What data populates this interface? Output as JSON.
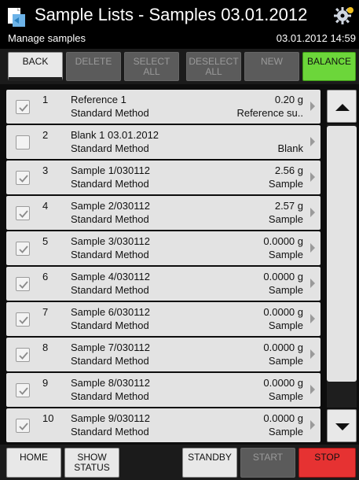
{
  "header": {
    "title": "Sample Lists - Samples 03.01.2012",
    "subtitle": "Manage samples",
    "datetime": "03.01.2012 14:59",
    "app_icon": "document-icon",
    "settings_icon": "gear-icon"
  },
  "toolbar": {
    "back": "BACK",
    "delete": "DELETE",
    "select_all": "SELECT\nALL",
    "deselect_all": "DESELECT\nALL",
    "new": "NEW",
    "balance": "BALANCE"
  },
  "rows": [
    {
      "checked": true,
      "index": "1",
      "name": "Reference 1",
      "method": "Standard Method",
      "amount": "0.20 g",
      "type": "Reference su.."
    },
    {
      "checked": false,
      "index": "2",
      "name": "Blank 1 03.01.2012",
      "method": "Standard Method",
      "amount": "",
      "type": "Blank"
    },
    {
      "checked": true,
      "index": "3",
      "name": "Sample 1/030112",
      "method": "Standard Method",
      "amount": "2.56 g",
      "type": "Sample"
    },
    {
      "checked": true,
      "index": "4",
      "name": "Sample 2/030112",
      "method": "Standard Method",
      "amount": "2.57 g",
      "type": "Sample"
    },
    {
      "checked": true,
      "index": "5",
      "name": "Sample 3/030112",
      "method": "Standard Method",
      "amount": "0.0000 g",
      "type": "Sample"
    },
    {
      "checked": true,
      "index": "6",
      "name": "Sample 4/030112",
      "method": "Standard Method",
      "amount": "0.0000 g",
      "type": "Sample"
    },
    {
      "checked": true,
      "index": "7",
      "name": "Sample 6/030112",
      "method": "Standard Method",
      "amount": "0.0000 g",
      "type": "Sample"
    },
    {
      "checked": true,
      "index": "8",
      "name": "Sample 7/030112",
      "method": "Standard Method",
      "amount": "0.0000 g",
      "type": "Sample"
    },
    {
      "checked": true,
      "index": "9",
      "name": "Sample 8/030112",
      "method": "Standard Method",
      "amount": "0.0000 g",
      "type": "Sample"
    },
    {
      "checked": true,
      "index": "10",
      "name": "Sample 9/030112",
      "method": "Standard Method",
      "amount": "0.0000 g",
      "type": "Sample"
    }
  ],
  "bottombar": {
    "home": "HOME",
    "show_status": "SHOW\nSTATUS",
    "standby": "STANDBY",
    "start": "START",
    "stop": "STOP"
  },
  "colors": {
    "balance": "#6cd63a",
    "stop": "#e63232",
    "row_bg": "#e3e3e3",
    "disabled": "#5b5b5b"
  }
}
